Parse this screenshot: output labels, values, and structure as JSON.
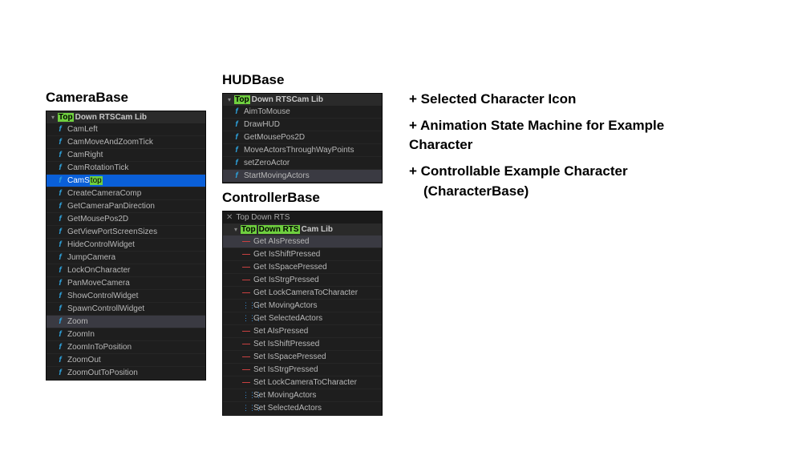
{
  "sections": {
    "camera": {
      "title": "CameraBase"
    },
    "hud": {
      "title": "HUDBase"
    },
    "controller": {
      "title": "ControllerBase"
    }
  },
  "cameraPanel": {
    "header_hl": "Top",
    "header_rest": " Down RTSCam Lib",
    "items": [
      {
        "icon": "fn",
        "label": "CamLeft"
      },
      {
        "icon": "fn",
        "label": "CamMoveAndZoomTick"
      },
      {
        "icon": "fn",
        "label": "CamRight"
      },
      {
        "icon": "fn",
        "label": "CamRotationTick"
      },
      {
        "icon": "fn",
        "label_pre": "CamS",
        "label_hl": "top",
        "selected": true
      },
      {
        "icon": "fn",
        "label": "CreateCameraComp"
      },
      {
        "icon": "fn",
        "label": "GetCameraPanDirection"
      },
      {
        "icon": "fn",
        "label": "GetMousePos2D"
      },
      {
        "icon": "fn",
        "label": "GetViewPortScreenSizes"
      },
      {
        "icon": "fn",
        "label": "HideControlWidget"
      },
      {
        "icon": "fn",
        "label": "JumpCamera"
      },
      {
        "icon": "fn",
        "label": "LockOnCharacter"
      },
      {
        "icon": "fn",
        "label": "PanMoveCamera"
      },
      {
        "icon": "fn",
        "label": "ShowControlWidget"
      },
      {
        "icon": "fn",
        "label": "SpawnControllWidget"
      },
      {
        "icon": "fn",
        "label": "Zoom",
        "highlighted": true
      },
      {
        "icon": "fn",
        "label": "ZoomIn"
      },
      {
        "icon": "fn",
        "label": "ZoomInToPosition"
      },
      {
        "icon": "fn",
        "label": "ZoomOut"
      },
      {
        "icon": "fn",
        "label": "ZoomOutToPosition"
      }
    ]
  },
  "hudPanel": {
    "header_hl": "Top",
    "header_rest": " Down RTSCam Lib",
    "items": [
      {
        "icon": "fn",
        "label": "AimToMouse"
      },
      {
        "icon": "fn",
        "label": "DrawHUD"
      },
      {
        "icon": "fn",
        "label": "GetMousePos2D"
      },
      {
        "icon": "fn",
        "label": "MoveActorsThroughWayPoints"
      },
      {
        "icon": "fn",
        "label": "setZeroActor"
      },
      {
        "icon": "fn",
        "label": "StartMovingActors",
        "highlighted": true
      }
    ]
  },
  "controllerPanel": {
    "tab": "Top Down RTS",
    "header_hl": "Top",
    "header_hl2": " Down RTS",
    "header_rest": "Cam Lib",
    "items": [
      {
        "icon": "dash",
        "label": "Get AIsPressed",
        "highlighted": true
      },
      {
        "icon": "dash",
        "label": "Get IsShiftPressed"
      },
      {
        "icon": "dash",
        "label": "Get IsSpacePressed"
      },
      {
        "icon": "dash",
        "label": "Get IsStrgPressed"
      },
      {
        "icon": "dash",
        "label": "Get LockCameraToCharacter"
      },
      {
        "icon": "grid",
        "label": "Get MovingActors"
      },
      {
        "icon": "grid",
        "label": "Get SelectedActors"
      },
      {
        "icon": "dash",
        "label": "Set AIsPressed"
      },
      {
        "icon": "dash",
        "label": "Set IsShiftPressed"
      },
      {
        "icon": "dash",
        "label": "Set IsSpacePressed"
      },
      {
        "icon": "dash",
        "label": "Set IsStrgPressed"
      },
      {
        "icon": "dash",
        "label": "Set LockCameraToCharacter"
      },
      {
        "icon": "grid",
        "label": "Set MovingActors"
      },
      {
        "icon": "grid",
        "label": "Set SelectedActors"
      }
    ]
  },
  "features": {
    "f1": "+ Selected Character Icon",
    "f2": "+ Animation State Machine for Example Character",
    "f3a": "+ Controllable Example Character",
    "f3b": "(CharacterBase)"
  }
}
